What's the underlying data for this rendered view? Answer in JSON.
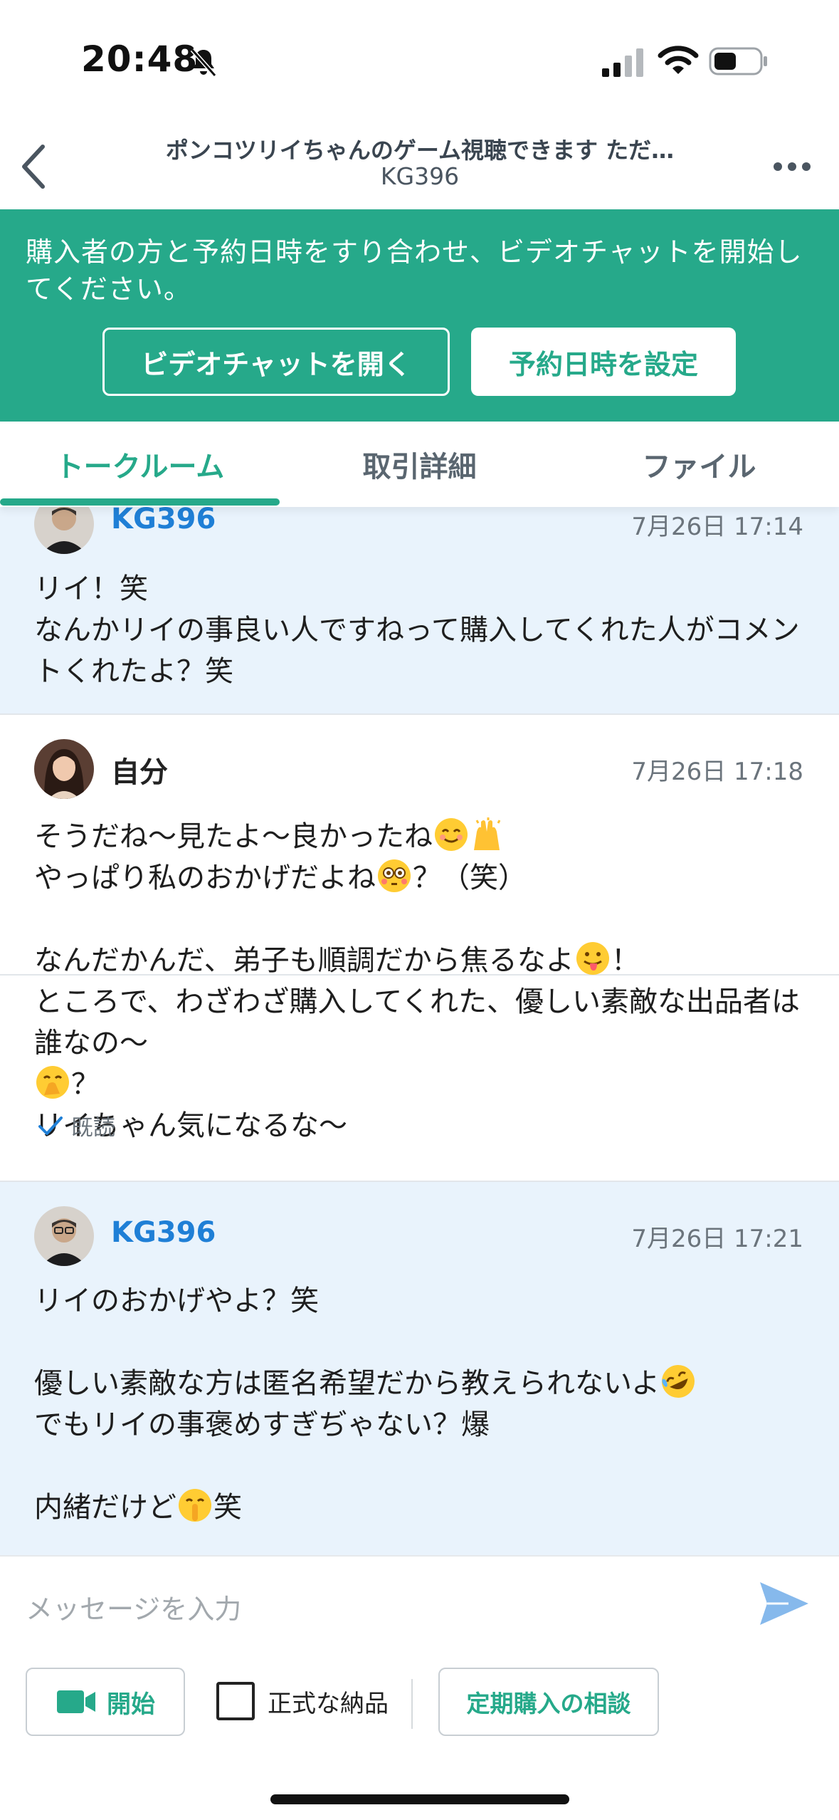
{
  "status_bar": {
    "time": "20:48"
  },
  "header": {
    "title": "ポンコツリイちゃんのゲーム視聴できます ただ…",
    "subtitle": "KG396"
  },
  "banner": {
    "text": "購入者の方と予約日時をすり合わせ、ビデオチャットを開始してください。",
    "open_video_label": "ビデオチャットを開く",
    "set_datetime_label": "予約日時を設定"
  },
  "tabs": [
    {
      "label": "トークルーム",
      "active": true
    },
    {
      "label": "取引詳細",
      "active": false
    },
    {
      "label": "ファイル",
      "active": false
    }
  ],
  "messages": [
    {
      "sender": "KG396",
      "time": "7月26日 17:14",
      "lines": [
        "リイ！笑",
        "なんかリイの事良い人ですねって購入してくれた人がコメントくれたよ？笑"
      ]
    },
    {
      "sender": "自分",
      "time": "7月26日 17:18",
      "line1": "そうだね〜見たよ〜良かったね",
      "line2a": "やっぱり私のおかげだよね",
      "line2b": "？（笑）",
      "line4a": "なんだかんだ、弟子も順調だから焦るなよ",
      "line4b": "！",
      "line5a": "ところで、わざわざ購入してくれた、優しい素敵な出品者は誰なの〜",
      "line5b": "？",
      "line6": "リイちゃん気になるな〜",
      "read_label": "既読"
    },
    {
      "sender": "KG396",
      "time": "7月26日 17:21",
      "line1": "リイのおかげやよ？笑",
      "line3": "優しい素敵な方は匿名希望だから教えられないよ",
      "line4": "でもリイの事褒めすぎぢゃない？爆",
      "line6a": "内緒だけど",
      "line6b": "笑"
    }
  ],
  "composer": {
    "placeholder": "メッセージを入力",
    "start_label": "開始",
    "formal_delivery_label": "正式な納品",
    "subscription_label": "定期購入の相談"
  },
  "colors": {
    "accent": "#26a98a",
    "link_blue": "#1f7fd6",
    "other_bg": "#e9f3fc"
  }
}
